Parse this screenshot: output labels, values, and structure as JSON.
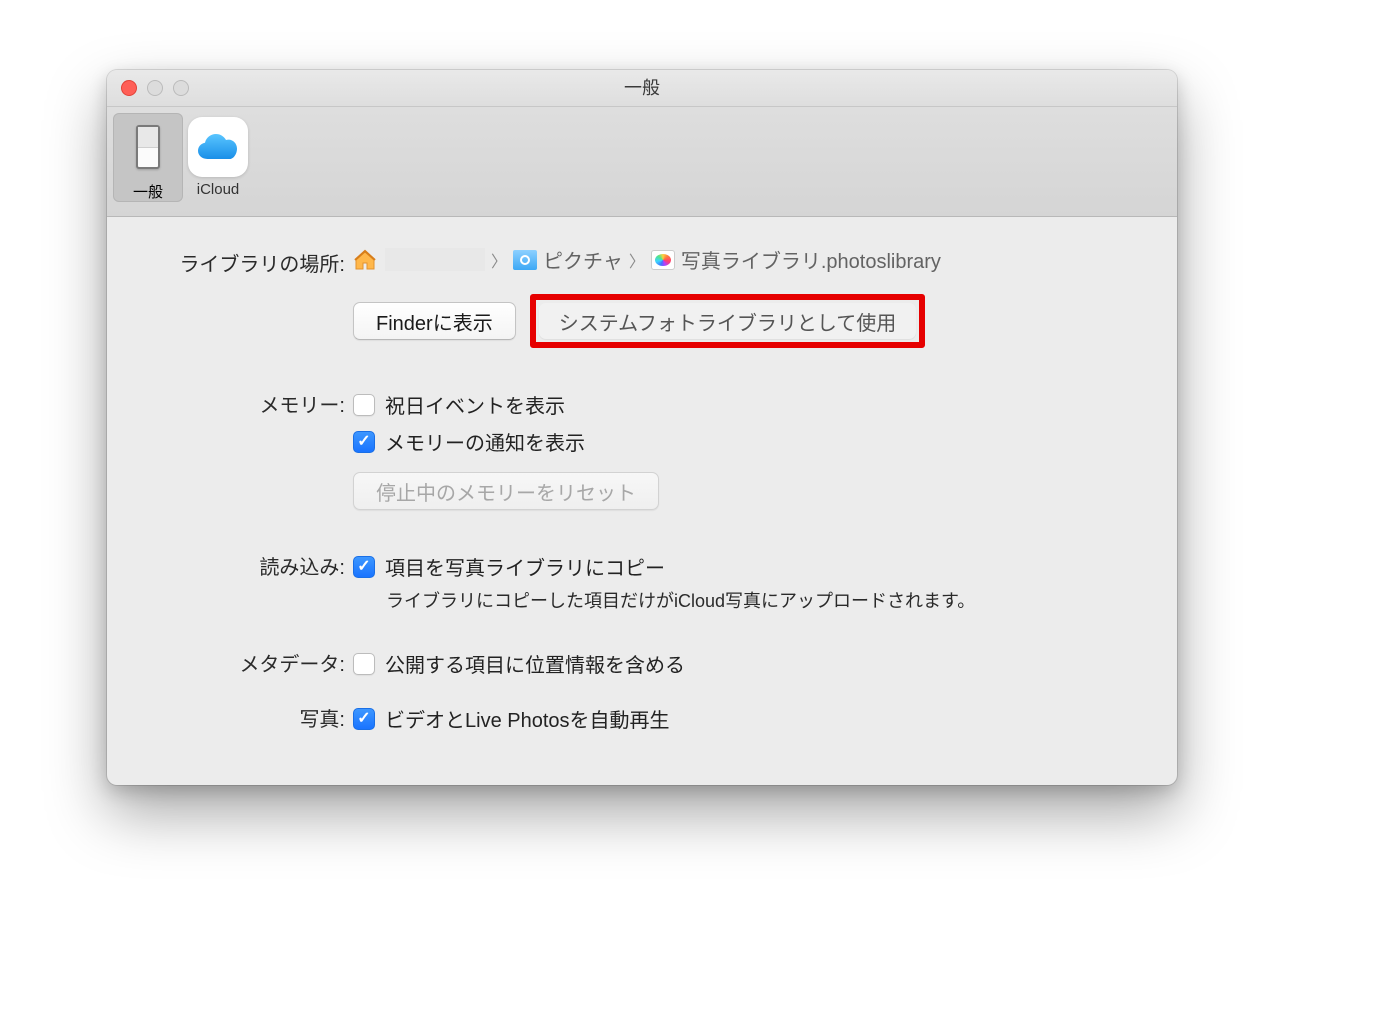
{
  "window": {
    "title": "一般"
  },
  "toolbar": {
    "general": "一般",
    "icloud": "iCloud"
  },
  "library": {
    "label": "ライブラリの場所:",
    "home_name": "",
    "pictures": "ピクチャ",
    "library_name": "写真ライブラリ.photoslibrary",
    "show_in_finder_btn": "Finderに表示",
    "use_as_system_btn": "システムフォトライブラリとして使用"
  },
  "memory": {
    "label": "メモリー:",
    "show_holiday_events": "祝日イベントを表示",
    "show_notifications": "メモリーの通知を表示",
    "reset_btn": "停止中のメモリーをリセット"
  },
  "import": {
    "label": "読み込み:",
    "copy_items": "項目を写真ライブラリにコピー",
    "copy_items_note": "ライブラリにコピーした項目だけがiCloud写真にアップロードされます。"
  },
  "metadata": {
    "label": "メタデータ:",
    "include_location": "公開する項目に位置情報を含める"
  },
  "photos": {
    "label": "写真:",
    "autoplay": "ビデオとLive Photosを自動再生"
  }
}
